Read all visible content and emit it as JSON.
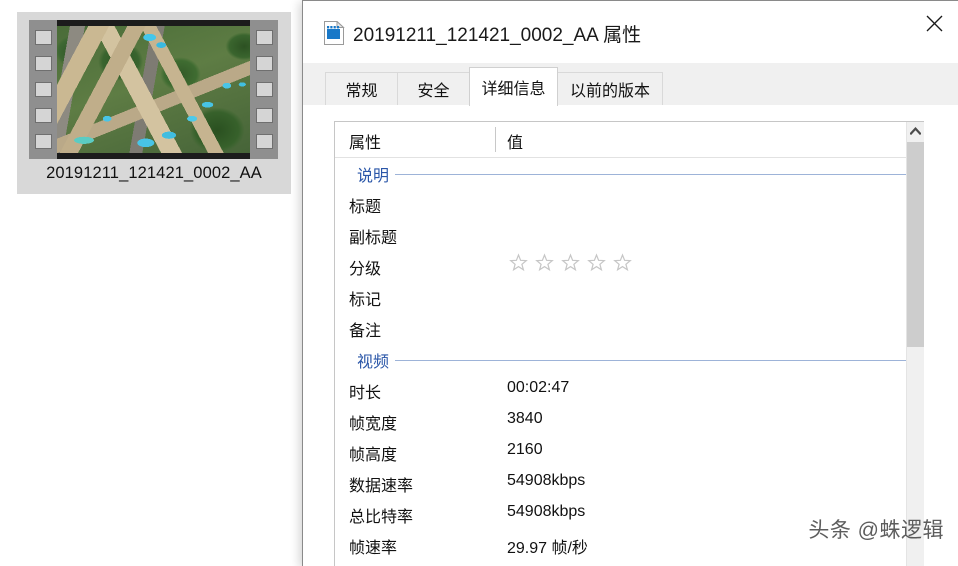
{
  "desktop": {
    "file_item": {
      "label": "20191211_121421_0002_AA",
      "thumbnail_alt": "aerial-view-resort-villas-pools"
    }
  },
  "dialog": {
    "icon_name": "video-file-icon",
    "title": "20191211_121421_0002_AA 属性",
    "close_label": "×",
    "tabs": [
      {
        "label": "常规",
        "active": false
      },
      {
        "label": "安全",
        "active": false
      },
      {
        "label": "详细信息",
        "active": true
      },
      {
        "label": "以前的版本",
        "active": false
      }
    ],
    "details": {
      "columns": [
        "属性",
        "值"
      ],
      "sections": [
        {
          "title": "说明",
          "rows": [
            {
              "name": "标题",
              "value": ""
            },
            {
              "name": "副标题",
              "value": ""
            },
            {
              "name": "分级",
              "value": "",
              "widget": "star-rating",
              "stars_total": 5,
              "stars_filled": 0
            },
            {
              "name": "标记",
              "value": ""
            },
            {
              "name": "备注",
              "value": ""
            }
          ]
        },
        {
          "title": "视频",
          "rows": [
            {
              "name": "时长",
              "value": "00:02:47"
            },
            {
              "name": "帧宽度",
              "value": "3840"
            },
            {
              "name": "帧高度",
              "value": "2160"
            },
            {
              "name": "数据速率",
              "value": "54908kbps"
            },
            {
              "name": "总比特率",
              "value": "54908kbps"
            },
            {
              "name": "帧速率",
              "value": "29.97 帧/秒"
            }
          ]
        }
      ],
      "scrollbar": {
        "up_arrow": "▲"
      }
    }
  },
  "watermark": {
    "text": "头条 @蛛逻辑"
  },
  "colors": {
    "section_header": "#2a56a8",
    "dialog_bg": "#ffffff",
    "tabstrip_bg": "#f0f0f0",
    "selection_bg": "#d8d8d8",
    "scroll_thumb": "#cdcdcd"
  }
}
